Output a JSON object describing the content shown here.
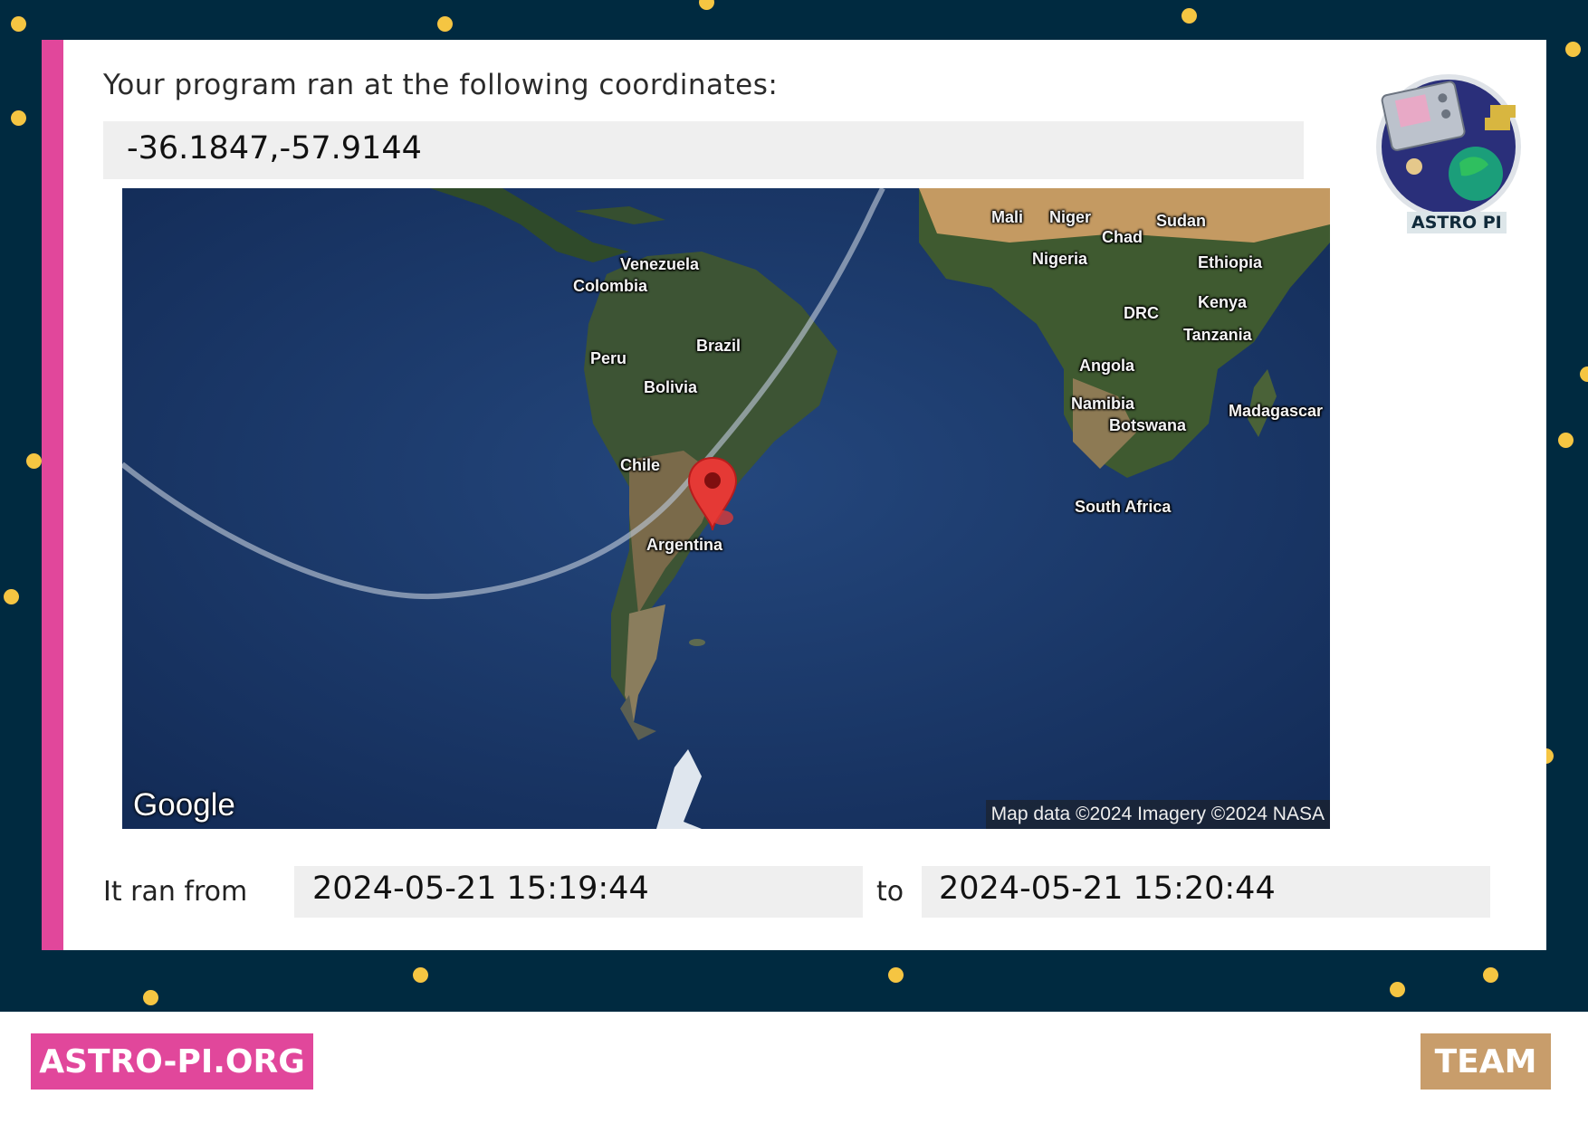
{
  "prompt": "Your program ran at the following coordinates:",
  "coordinates": "-36.1847,-57.9144",
  "map": {
    "labels": {
      "mali": "Mali",
      "niger": "Niger",
      "sudan": "Sudan",
      "chad": "Chad",
      "venezuela": "Venezuela",
      "nigeria": "Nigeria",
      "ethiopia": "Ethiopia",
      "colombia": "Colombia",
      "kenya": "Kenya",
      "drc": "DRC",
      "brazil": "Brazil",
      "tanzania": "Tanzania",
      "peru": "Peru",
      "angola": "Angola",
      "bolivia": "Bolivia",
      "namibia": "Namibia",
      "madagascar": "Madagascar",
      "botswana": "Botswana",
      "chile": "Chile",
      "south_africa": "South Africa",
      "argentina": "Argentina"
    },
    "google_logo": "Google",
    "attribution": "Map data ©2024 Imagery ©2024 NASA"
  },
  "time": {
    "from_label": "It ran from",
    "start": "2024-05-21 15:19:44",
    "to_label": "to",
    "end": "2024-05-21 15:20:44"
  },
  "badge": {
    "label": "ASTRO PI"
  },
  "footer": {
    "site": "ASTRO-PI.ORG",
    "team": "TEAM"
  },
  "colors": {
    "background": "#002a40",
    "accent_pink": "#e1479b",
    "accent_tan": "#c89d6b",
    "star_yellow": "#f5c542",
    "pin_red": "#e53935"
  }
}
